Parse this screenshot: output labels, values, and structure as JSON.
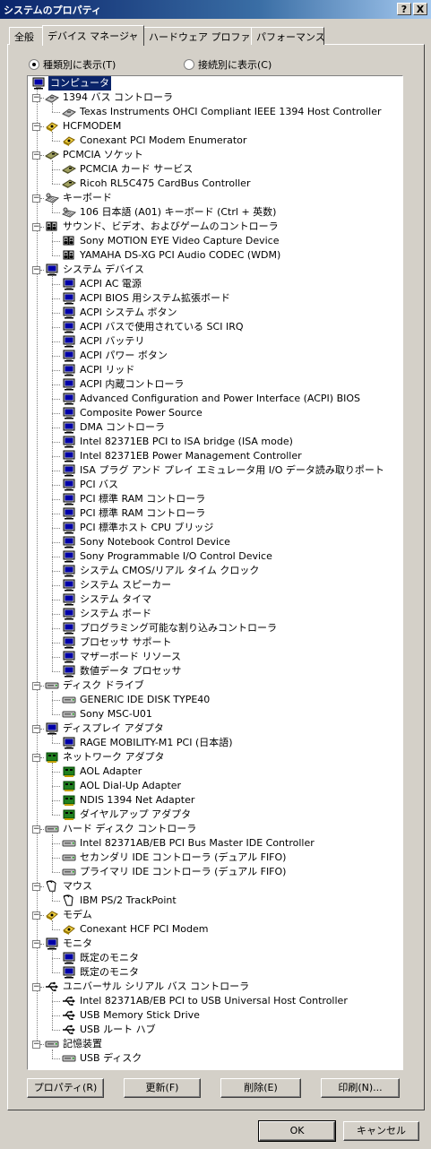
{
  "window": {
    "title": "システムのプロパティ",
    "help_button": "?",
    "close_button": "X"
  },
  "tabs": [
    {
      "label": "全般",
      "active": false
    },
    {
      "label": "デバイス マネージャ",
      "active": true
    },
    {
      "label": "ハードウェア プロファイル",
      "active": false
    },
    {
      "label": "パフォーマンス",
      "active": false
    }
  ],
  "view_options": {
    "by_type": {
      "label": "種類別に表示(T)",
      "checked": true
    },
    "by_connection": {
      "label": "接続別に表示(C)",
      "checked": false
    }
  },
  "tree": {
    "root": {
      "label": "コンピュータ",
      "icon": "computer-icon",
      "selected": true
    },
    "categories": [
      {
        "label": "1394 バス コントローラ",
        "icon": "controller-icon",
        "children": [
          {
            "label": "Texas Instruments OHCI Compliant IEEE 1394 Host Controller",
            "icon": "controller-icon"
          }
        ]
      },
      {
        "label": "HCFMODEM",
        "icon": "modem-icon",
        "children": [
          {
            "label": "Conexant PCI Modem Enumerator",
            "icon": "modem-icon"
          }
        ]
      },
      {
        "label": "PCMCIA ソケット",
        "icon": "pcmcia-icon",
        "children": [
          {
            "label": "PCMCIA カード サービス",
            "icon": "pcmcia-icon"
          },
          {
            "label": "Ricoh RL5C475 CardBus Controller",
            "icon": "pcmcia-icon"
          }
        ]
      },
      {
        "label": "キーボード",
        "icon": "keyboard-icon",
        "children": [
          {
            "label": "106 日本語 (A01) キーボード (Ctrl + 英数)",
            "icon": "keyboard-icon"
          }
        ]
      },
      {
        "label": "サウンド、ビデオ、およびゲームのコントローラ",
        "icon": "sound-icon",
        "children": [
          {
            "label": "Sony MOTION EYE Video Capture Device",
            "icon": "sound-icon"
          },
          {
            "label": "YAMAHA DS-XG PCI Audio CODEC (WDM)",
            "icon": "sound-icon"
          }
        ]
      },
      {
        "label": "システム デバイス",
        "icon": "system-device-icon",
        "children": [
          {
            "label": "ACPI AC 電源",
            "icon": "system-device-icon"
          },
          {
            "label": "ACPI BIOS 用システム拡張ボード",
            "icon": "system-device-icon"
          },
          {
            "label": "ACPI システム ボタン",
            "icon": "system-device-icon"
          },
          {
            "label": "ACPI バスで使用されている SCI IRQ",
            "icon": "system-device-icon"
          },
          {
            "label": "ACPI バッテリ",
            "icon": "system-device-icon"
          },
          {
            "label": "ACPI パワー ボタン",
            "icon": "system-device-icon"
          },
          {
            "label": "ACPI リッド",
            "icon": "system-device-icon"
          },
          {
            "label": "ACPI 内蔵コントローラ",
            "icon": "system-device-icon"
          },
          {
            "label": "Advanced Configuration and Power Interface (ACPI) BIOS",
            "icon": "system-device-icon"
          },
          {
            "label": "Composite Power Source",
            "icon": "system-device-icon"
          },
          {
            "label": "DMA コントローラ",
            "icon": "system-device-icon"
          },
          {
            "label": "Intel 82371EB PCI to ISA bridge (ISA mode)",
            "icon": "system-device-icon"
          },
          {
            "label": "Intel 82371EB Power Management Controller",
            "icon": "system-device-icon"
          },
          {
            "label": "ISA プラグ アンド プレイ エミュレータ用 I/O データ読み取りポート",
            "icon": "system-device-icon"
          },
          {
            "label": "PCI バス",
            "icon": "system-device-icon"
          },
          {
            "label": "PCI 標準 RAM コントローラ",
            "icon": "system-device-icon"
          },
          {
            "label": "PCI 標準 RAM コントローラ",
            "icon": "system-device-icon"
          },
          {
            "label": "PCI 標準ホスト CPU ブリッジ",
            "icon": "system-device-icon"
          },
          {
            "label": "Sony Notebook Control Device",
            "icon": "system-device-icon"
          },
          {
            "label": "Sony Programmable I/O Control Device",
            "icon": "system-device-icon"
          },
          {
            "label": "システム CMOS/リアル タイム クロック",
            "icon": "system-device-icon"
          },
          {
            "label": "システム スピーカー",
            "icon": "system-device-icon"
          },
          {
            "label": "システム タイマ",
            "icon": "system-device-icon"
          },
          {
            "label": "システム ボード",
            "icon": "system-device-icon"
          },
          {
            "label": "プログラミング可能な割り込みコントローラ",
            "icon": "system-device-icon"
          },
          {
            "label": "プロセッサ サポート",
            "icon": "system-device-icon"
          },
          {
            "label": "マザーボード リソース",
            "icon": "system-device-icon"
          },
          {
            "label": "数値データ プロセッサ",
            "icon": "system-device-icon"
          }
        ]
      },
      {
        "label": "ディスク ドライブ",
        "icon": "disk-icon",
        "children": [
          {
            "label": "GENERIC IDE  DISK TYPE40",
            "icon": "disk-icon"
          },
          {
            "label": "Sony MSC-U01",
            "icon": "disk-icon"
          }
        ]
      },
      {
        "label": "ディスプレイ アダプタ",
        "icon": "display-icon",
        "children": [
          {
            "label": "RAGE MOBILITY-M1 PCI (日本語)",
            "icon": "display-icon"
          }
        ]
      },
      {
        "label": "ネットワーク アダプタ",
        "icon": "network-icon",
        "children": [
          {
            "label": "AOL Adapter",
            "icon": "network-icon"
          },
          {
            "label": "AOL Dial-Up Adapter",
            "icon": "network-icon"
          },
          {
            "label": "NDIS 1394 Net Adapter",
            "icon": "network-icon"
          },
          {
            "label": "ダイヤルアップ アダプタ",
            "icon": "network-icon"
          }
        ]
      },
      {
        "label": "ハード ディスク コントローラ",
        "icon": "hdd-controller-icon",
        "children": [
          {
            "label": "Intel 82371AB/EB PCI Bus Master IDE Controller",
            "icon": "hdd-controller-icon"
          },
          {
            "label": "セカンダリ IDE コントローラ (デュアル FIFO)",
            "icon": "hdd-controller-icon"
          },
          {
            "label": "プライマリ IDE コントローラ (デュアル FIFO)",
            "icon": "hdd-controller-icon"
          }
        ]
      },
      {
        "label": "マウス",
        "icon": "mouse-icon",
        "children": [
          {
            "label": "IBM PS/2 TrackPoint",
            "icon": "mouse-icon"
          }
        ]
      },
      {
        "label": "モデム",
        "icon": "modem-icon",
        "children": [
          {
            "label": "Conexant HCF PCI Modem",
            "icon": "modem-icon"
          }
        ]
      },
      {
        "label": "モニタ",
        "icon": "monitor-icon",
        "children": [
          {
            "label": "既定のモニタ",
            "icon": "monitor-icon"
          },
          {
            "label": "既定のモニタ",
            "icon": "monitor-icon"
          }
        ]
      },
      {
        "label": "ユニバーサル シリアル バス コントローラ",
        "icon": "usb-icon",
        "children": [
          {
            "label": "Intel 82371AB/EB PCI to USB Universal Host Controller",
            "icon": "usb-icon"
          },
          {
            "label": "USB Memory Stick Drive",
            "icon": "usb-icon"
          },
          {
            "label": "USB ルート ハブ",
            "icon": "usb-icon"
          }
        ]
      },
      {
        "label": "記憶装置",
        "icon": "storage-icon",
        "children": [
          {
            "label": "USB ディスク",
            "icon": "storage-icon"
          }
        ]
      }
    ]
  },
  "action_buttons": {
    "properties": "プロパティ(R)",
    "refresh": "更新(F)",
    "remove": "削除(E)",
    "print": "印刷(N)..."
  },
  "dialog_buttons": {
    "ok": "OK",
    "cancel": "キャンセル"
  }
}
